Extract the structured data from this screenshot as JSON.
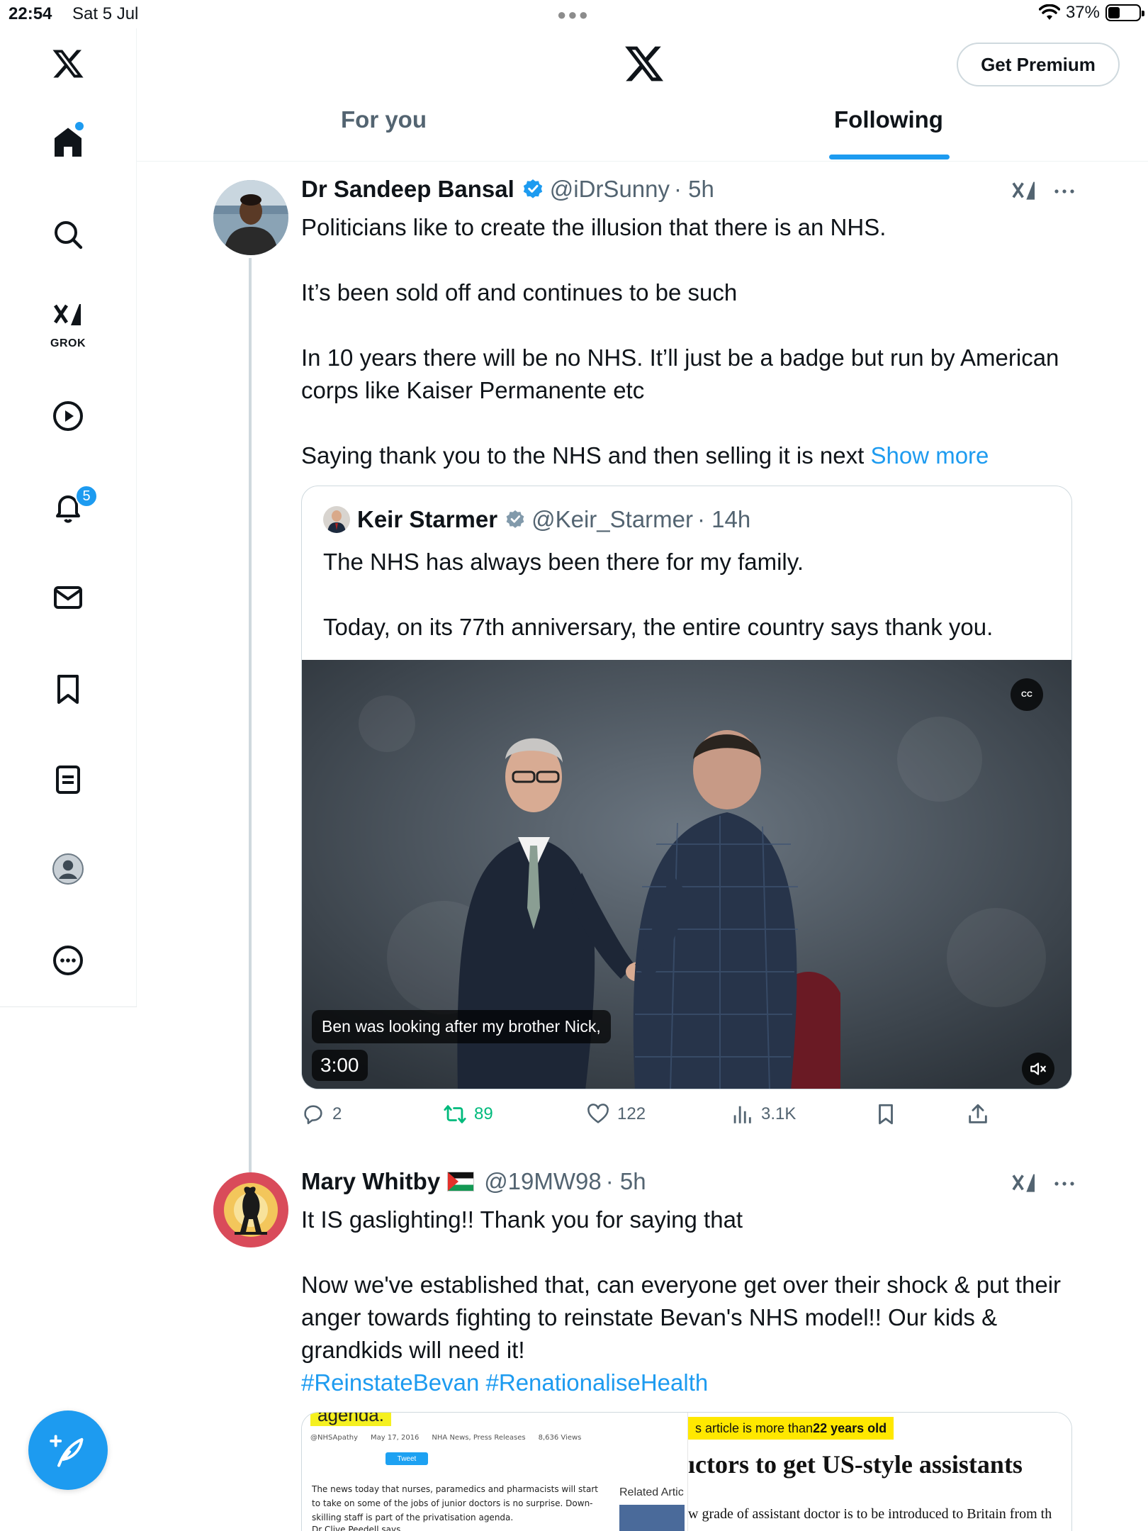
{
  "status_bar": {
    "time": "22:54",
    "date": "Sat 5 Jul",
    "battery": "37%",
    "battery_level": 0.37
  },
  "header": {
    "premium_label": "Get Premium",
    "tabs": [
      {
        "label": "For you",
        "active": false
      },
      {
        "label": "Following",
        "active": true
      }
    ]
  },
  "nav": {
    "grok_label": "GROK",
    "notifications_count": "5"
  },
  "tweets": [
    {
      "display_name": "Dr Sandeep Bansal",
      "handle": "@iDrSunny",
      "time": "· 5h",
      "paragraphs": [
        "Politicians like to create the illusion that there is an NHS.",
        "It’s been sold off and continues to be such",
        "In 10 years there will be no NHS. It’ll just be a badge but run by American corps like Kaiser Permanente etc",
        "Saying thank you to the NHS and then selling it is next"
      ],
      "show_more": "Show more",
      "quote": {
        "display_name": "Keir Starmer",
        "handle": "@Keir_Starmer",
        "time": "· 14h",
        "paragraphs": [
          "The NHS has always been there for my family.",
          "Today, on its 77th anniversary, the entire country says thank you."
        ],
        "video": {
          "caption": "Ben was looking after my brother Nick,",
          "duration": "3:00",
          "cc_label": "CC"
        }
      },
      "stats": {
        "replies": "2",
        "retweets": "89",
        "likes": "122",
        "views": "3.1K"
      }
    },
    {
      "display_name": "Mary Whitby",
      "handle": "@19MW98",
      "time": "· 5h",
      "paragraphs": [
        "It IS gaslighting!! Thank you for saying that",
        "Now we've established that, can everyone get over their shock & put their anger towards fighting to reinstate Bevan's NHS model!! Our kids & grandkids will need it!"
      ],
      "hashtags": "#ReinstateBevan #RenationaliseHealth",
      "media": {
        "left_heading": "agenda.",
        "left_meta": [
          "@NHSApathy",
          "May 17, 2016",
          "NHA News, Press Releases",
          "8,636 Views"
        ],
        "tweet_btn": "Tweet",
        "left_body": "The news today that nurses, paramedics and pharmacists will start to take on some of the jobs of junior doctors is no surprise. Down-skilling staff is part of the privatisation agenda.",
        "left_body_tail": "Dr Clive Peedell says",
        "related": "Related Artic",
        "age_banner_pre": "s article is more than ",
        "age_banner_bold": "22 years old",
        "right_headline": "ıctors to get US-style assistants",
        "right_body": "w grade of assistant doctor is to be introduced to Britain from th"
      }
    }
  ],
  "colors": {
    "accent": "#1d9bf0",
    "retweet_green": "#00ba7c",
    "muted": "#536471"
  }
}
